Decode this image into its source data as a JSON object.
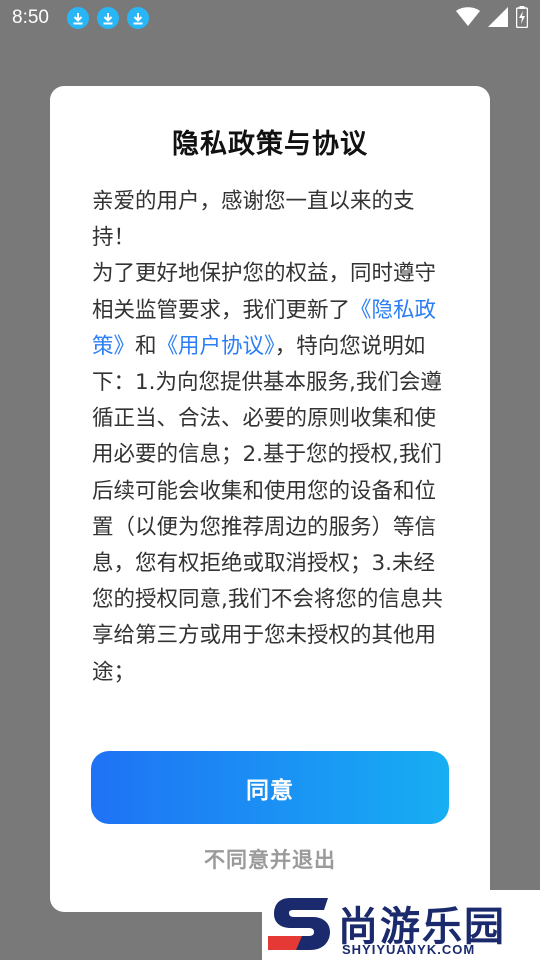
{
  "status_bar": {
    "time": "8:50",
    "icons": [
      "download-icon",
      "download-icon",
      "download-icon",
      "wifi-icon",
      "signal-icon",
      "battery-icon"
    ]
  },
  "dialog": {
    "title": "隐私政策与协议",
    "greeting": "亲爱的用户，感谢您一直以来的支持！",
    "para_intro": "为了更好地保护您的权益，同时遵守相关监管要求，我们更新了",
    "privacy_link": "《隐私政策》",
    "conj": "和",
    "user_agreement_link": "《用户协议》",
    "para_rest": "，特向您说明如下：1.为向您提供基本服务,我们会遵循正当、合法、必要的原则收集和使用必要的信息；2.基于您的授权,我们后续可能会收集和使用您的设备和位置（以便为您推荐周边的服务）等信息，您有权拒绝或取消授权；3.未经您的授权同意,我们不会将您的信息共享给第三方或用于您未授权的其他用途；",
    "agree_label": "同意",
    "decline_label": "不同意并退出"
  },
  "watermark": {
    "title": "尚游乐园",
    "domain": "SHYIYUANYK.COM"
  },
  "colors": {
    "link": "#2b7ef5",
    "button_start": "#1f72f5",
    "button_end": "#17aef3",
    "overlay": "#797979"
  }
}
